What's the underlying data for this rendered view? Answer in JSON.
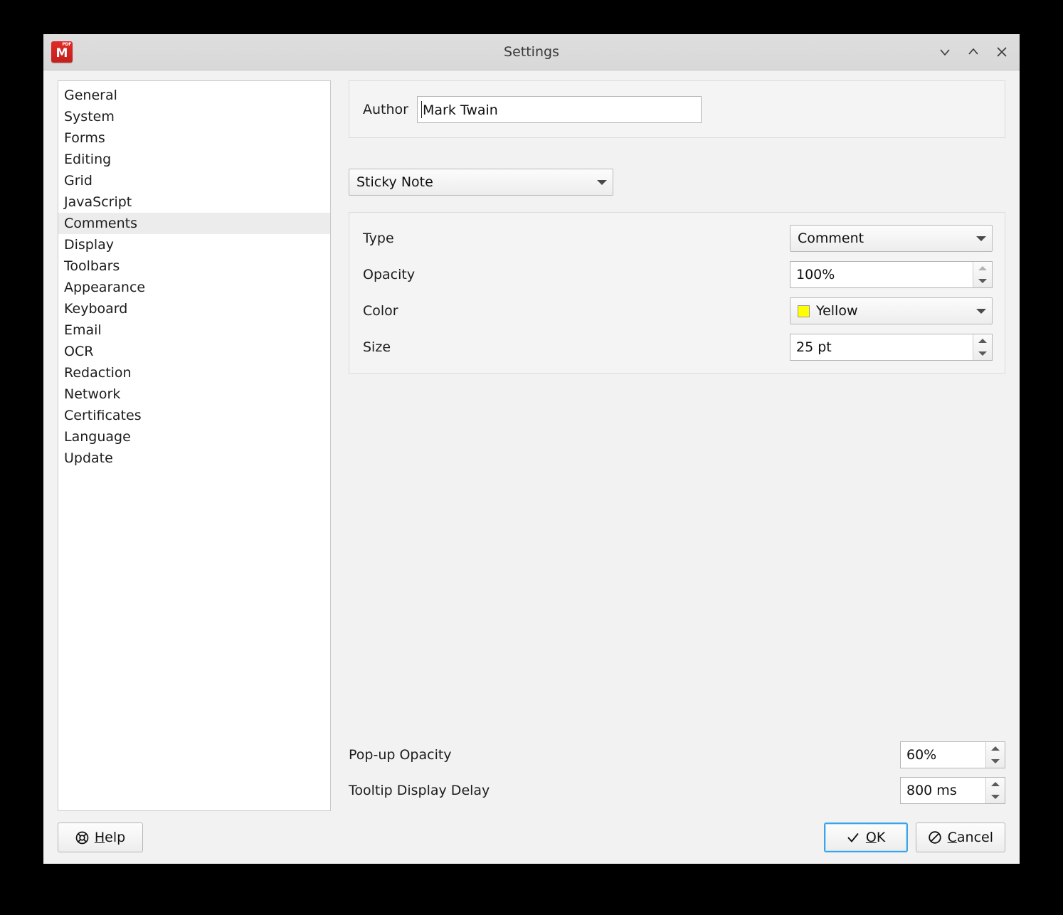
{
  "window": {
    "title": "Settings",
    "app_icon": "master-pdf-editor-icon",
    "icon_badge": "PDF",
    "icon_letter": "M",
    "controls": [
      {
        "name": "minimize-button",
        "icon": "chevron-down-icon"
      },
      {
        "name": "maximize-button",
        "icon": "chevron-up-icon"
      },
      {
        "name": "close-button",
        "icon": "close-x-icon"
      }
    ]
  },
  "sidebar": {
    "selected": "Comments",
    "items": [
      {
        "label": "General"
      },
      {
        "label": "System"
      },
      {
        "label": "Forms"
      },
      {
        "label": "Editing"
      },
      {
        "label": "Grid"
      },
      {
        "label": "JavaScript"
      },
      {
        "label": "Comments"
      },
      {
        "label": "Display"
      },
      {
        "label": "Toolbars"
      },
      {
        "label": "Appearance"
      },
      {
        "label": "Keyboard"
      },
      {
        "label": "Email"
      },
      {
        "label": "OCR"
      },
      {
        "label": "Redaction"
      },
      {
        "label": "Network"
      },
      {
        "label": "Certificates"
      },
      {
        "label": "Language"
      },
      {
        "label": "Update"
      }
    ]
  },
  "content": {
    "author": {
      "label": "Author",
      "value": "Mark Twain",
      "placeholder": ""
    },
    "annotation_selector": {
      "value": "Sticky Note",
      "icon": "chevron-down-icon"
    },
    "properties": [
      {
        "label": "Type",
        "control": "combo",
        "value": "Comment",
        "icon": "chevron-down-icon"
      },
      {
        "label": "Opacity",
        "control": "spin",
        "value": "100%",
        "up_enabled": false,
        "down_enabled": true
      },
      {
        "label": "Color",
        "control": "combo-color",
        "value": "Yellow",
        "swatch": "#FFFF00",
        "icon": "chevron-down-icon"
      },
      {
        "label": "Size",
        "control": "spin",
        "value": "25 pt",
        "up_enabled": true,
        "down_enabled": true
      }
    ],
    "bottom_settings": [
      {
        "label": "Pop-up Opacity",
        "value": "60%",
        "up_enabled": true,
        "down_enabled": true
      },
      {
        "label": "Tooltip Display Delay",
        "value": "800 ms",
        "up_enabled": true,
        "down_enabled": true
      }
    ]
  },
  "buttons": {
    "help": {
      "accel": "H",
      "rest": "elp",
      "icon": "lifebuoy-icon"
    },
    "ok": {
      "accel": "O",
      "rest": "K",
      "icon": "checkmark-icon",
      "focused": true
    },
    "cancel": {
      "accel": "C",
      "rest": "ancel",
      "icon": "no-entry-icon"
    }
  }
}
